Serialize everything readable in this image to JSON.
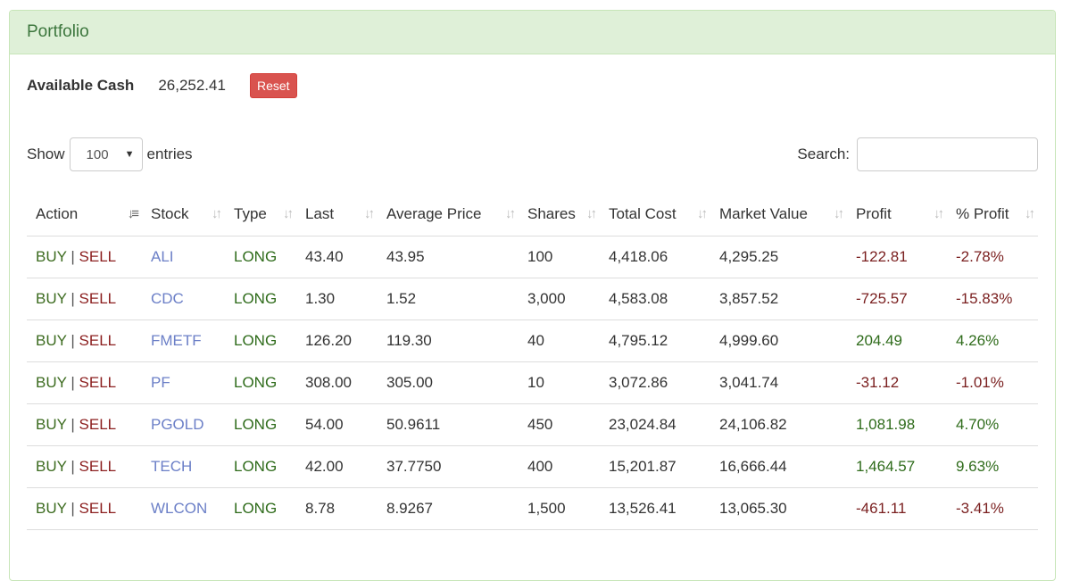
{
  "panel": {
    "title": "Portfolio"
  },
  "cash": {
    "label": "Available Cash",
    "value": "26,252.41",
    "reset_label": "Reset"
  },
  "length": {
    "show_label": "Show",
    "selected": "100",
    "entries_label": "entries"
  },
  "search": {
    "label": "Search:",
    "value": "",
    "placeholder": ""
  },
  "table": {
    "columns": [
      "Action",
      "Stock",
      "Type",
      "Last",
      "Average Price",
      "Shares",
      "Total Cost",
      "Market Value",
      "Profit",
      "% Profit"
    ],
    "action": {
      "buy": "BUY",
      "separator": "|",
      "sell": "SELL"
    },
    "rows": [
      {
        "stock": "ALI",
        "type": "LONG",
        "last": "43.40",
        "avg": "43.95",
        "shares": "100",
        "cost": "4,418.06",
        "market": "4,295.25",
        "profit": "-122.81",
        "pct": "-2.78%",
        "sign": "neg"
      },
      {
        "stock": "CDC",
        "type": "LONG",
        "last": "1.30",
        "avg": "1.52",
        "shares": "3,000",
        "cost": "4,583.08",
        "market": "3,857.52",
        "profit": "-725.57",
        "pct": "-15.83%",
        "sign": "neg"
      },
      {
        "stock": "FMETF",
        "type": "LONG",
        "last": "126.20",
        "avg": "119.30",
        "shares": "40",
        "cost": "4,795.12",
        "market": "4,999.60",
        "profit": "204.49",
        "pct": "4.26%",
        "sign": "pos"
      },
      {
        "stock": "PF",
        "type": "LONG",
        "last": "308.00",
        "avg": "305.00",
        "shares": "10",
        "cost": "3,072.86",
        "market": "3,041.74",
        "profit": "-31.12",
        "pct": "-1.01%",
        "sign": "neg"
      },
      {
        "stock": "PGOLD",
        "type": "LONG",
        "last": "54.00",
        "avg": "50.9611",
        "shares": "450",
        "cost": "23,024.84",
        "market": "24,106.82",
        "profit": "1,081.98",
        "pct": "4.70%",
        "sign": "pos"
      },
      {
        "stock": "TECH",
        "type": "LONG",
        "last": "42.00",
        "avg": "37.7750",
        "shares": "400",
        "cost": "15,201.87",
        "market": "16,666.44",
        "profit": "1,464.57",
        "pct": "9.63%",
        "sign": "pos"
      },
      {
        "stock": "WLCON",
        "type": "LONG",
        "last": "8.78",
        "avg": "8.9267",
        "shares": "1,500",
        "cost": "13,526.41",
        "market": "13,065.30",
        "profit": "-461.11",
        "pct": "-3.41%",
        "sign": "neg"
      }
    ]
  },
  "colors": {
    "heading_bg": "#dff0d8",
    "heading_text": "#3c763d",
    "reset_bg": "#d9534f",
    "positive": "#2e6b1a",
    "negative": "#7a1f1f",
    "link": "#6b7fc7"
  },
  "icons": {
    "sort": "sort-arrows-icon",
    "sort_active": "sort-amount-icon",
    "dropdown": "caret-down-icon"
  }
}
